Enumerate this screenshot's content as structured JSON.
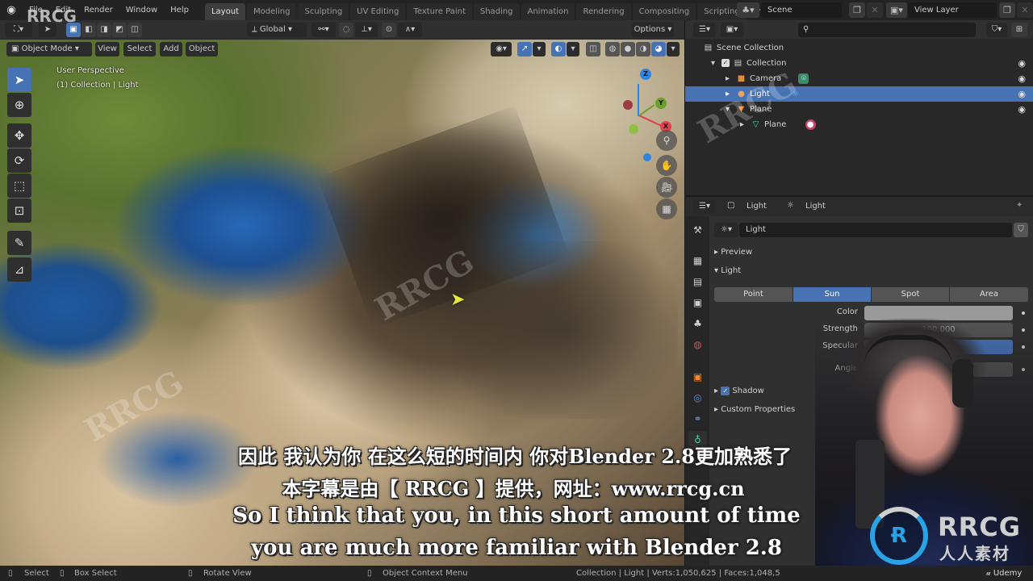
{
  "app": {
    "watermark_top": "RRCG"
  },
  "menu": [
    "File",
    "Edit",
    "Render",
    "Window",
    "Help"
  ],
  "workspace_tabs": [
    {
      "label": "Layout",
      "active": true
    },
    {
      "label": "Modeling"
    },
    {
      "label": "Sculpting"
    },
    {
      "label": "UV Editing"
    },
    {
      "label": "Texture Paint"
    },
    {
      "label": "Shading"
    },
    {
      "label": "Animation"
    },
    {
      "label": "Rendering"
    },
    {
      "label": "Compositing"
    },
    {
      "label": "Scripting"
    }
  ],
  "add_workspace": "+",
  "scene": {
    "label": "Scene"
  },
  "view_layer": {
    "label": "View Layer"
  },
  "viewport_header": {
    "mode": "Object Mode",
    "menus": [
      "View",
      "Select",
      "Add",
      "Object"
    ],
    "transform_orientation": "Global",
    "options": "Options"
  },
  "viewport": {
    "perspective": "User Perspective",
    "context": "(1) Collection | Light",
    "gizmo": {
      "z": "Z",
      "y": "Y",
      "x": "X"
    },
    "colors": {
      "x": "#e0414f",
      "y": "#6b9f27",
      "z": "#2f84e3"
    }
  },
  "tools": [
    "select-box",
    "cursor",
    "move",
    "rotate",
    "scale",
    "transform",
    "annotate",
    "measure"
  ],
  "outliner": {
    "search_placeholder": "",
    "items": [
      {
        "label": "Scene Collection",
        "icon": "collection-icon",
        "depth": 0
      },
      {
        "label": "Collection",
        "icon": "collection-icon",
        "depth": 1,
        "checked": true,
        "visible": true
      },
      {
        "label": "Camera",
        "icon": "camera-icon",
        "depth": 2,
        "visible": true
      },
      {
        "label": "Light",
        "icon": "light-icon",
        "depth": 2,
        "visible": true,
        "selected": true
      },
      {
        "label": "Plane",
        "icon": "mesh-icon",
        "depth": 2,
        "visible": true
      },
      {
        "label": "Plane",
        "icon": "mesh-data-icon",
        "depth": 3
      }
    ]
  },
  "properties": {
    "breadcrumb": [
      "Light",
      "Light"
    ],
    "datablock_name": "Light",
    "panels": {
      "preview": "Preview",
      "light": "Light",
      "shadow": "Shadow",
      "custom": "Custom Properties"
    },
    "light_types": [
      "Point",
      "Sun",
      "Spot",
      "Area"
    ],
    "active_type": "Sun",
    "fields": {
      "color_label": "Color",
      "strength_label": "Strength",
      "strength_value": "100.000",
      "specular_label": "Specular",
      "angle_label": "Angle"
    },
    "shadow_enabled": true
  },
  "statusbar": {
    "select": "Select",
    "box_select": "Box Select",
    "rotate_view": "Rotate View",
    "context_menu": "Object Context Menu",
    "stats": "Collection | Light | Verts:1,050,625 | Faces:1,048,5",
    "brand": "Udemy"
  },
  "subtitles": {
    "zh1": "因此 我认为你 在这么短的时间内 你对Blender 2.8更加熟悉了",
    "zh2": "本字幕是由【 RRCG 】提供，网址：www.rrcg.cn",
    "en1": "So I think that you, in this short amount of time",
    "en2": "you are much more familiar with Blender 2.8"
  },
  "logo": {
    "text": "RRCG",
    "sub": "人人素材"
  }
}
